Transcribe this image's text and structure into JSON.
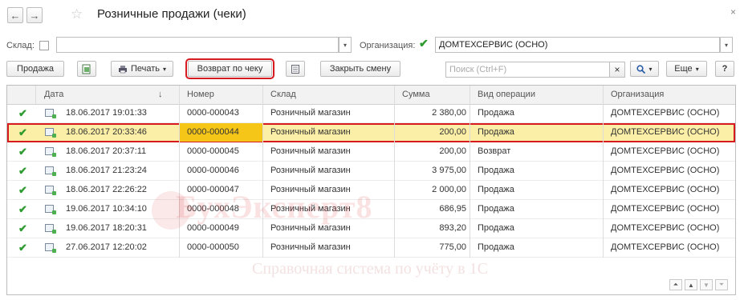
{
  "window": {
    "title": "Розничные продажи (чеки)",
    "close_glyph": "×",
    "back_glyph": "←",
    "forward_glyph": "→",
    "favorite_glyph": "☆"
  },
  "filters": {
    "warehouse_label": "Склад:",
    "warehouse_value": "",
    "warehouse_checked": false,
    "org_label": "Организация:",
    "org_checked": true,
    "org_value": "ДОМТЕХСЕРВИС (ОСНО)",
    "dropdown_glyph": "▾"
  },
  "toolbar": {
    "sale_label": "Продажа",
    "print_label": "Печать",
    "return_label": "Возврат по чеку",
    "close_shift_label": "Закрыть смену",
    "search_placeholder": "Поиск (Ctrl+F)",
    "clear_glyph": "×",
    "more_label": "Еще",
    "help_label": "?",
    "dropdown_glyph": "▾",
    "sort_glyph": "↓"
  },
  "table": {
    "columns": [
      "Дата",
      "Номер",
      "Склад",
      "Сумма",
      "Вид операции",
      "Организация"
    ],
    "check_glyph": "✔",
    "rows": [
      {
        "date": "18.06.2017 19:01:33",
        "number": "0000-000043",
        "warehouse": "Розничный магазин",
        "sum": "2 380,00",
        "operation": "Продажа",
        "org": "ДОМТЕХСЕРВИС (ОСНО)"
      },
      {
        "date": "18.06.2017 20:33:46",
        "number": "0000-000044",
        "warehouse": "Розничный магазин",
        "sum": "200,00",
        "operation": "Продажа",
        "org": "ДОМТЕХСЕРВИС (ОСНО)"
      },
      {
        "date": "18.06.2017 20:37:11",
        "number": "0000-000045",
        "warehouse": "Розничный магазин",
        "sum": "200,00",
        "operation": "Возврат",
        "org": "ДОМТЕХСЕРВИС (ОСНО)"
      },
      {
        "date": "18.06.2017 21:23:24",
        "number": "0000-000046",
        "warehouse": "Розничный магазин",
        "sum": "3 975,00",
        "operation": "Продажа",
        "org": "ДОМТЕХСЕРВИС (ОСНО)"
      },
      {
        "date": "18.06.2017 22:26:22",
        "number": "0000-000047",
        "warehouse": "Розничный магазин",
        "sum": "2 000,00",
        "operation": "Продажа",
        "org": "ДОМТЕХСЕРВИС (ОСНО)"
      },
      {
        "date": "19.06.2017 10:34:10",
        "number": "0000-000048",
        "warehouse": "Розничный магазин",
        "sum": "686,95",
        "operation": "Продажа",
        "org": "ДОМТЕХСЕРВИС (ОСНО)"
      },
      {
        "date": "19.06.2017 18:20:31",
        "number": "0000-000049",
        "warehouse": "Розничный магазин",
        "sum": "893,20",
        "operation": "Продажа",
        "org": "ДОМТЕХСЕРВИС (ОСНО)"
      },
      {
        "date": "27.06.2017 12:20:02",
        "number": "0000-000050",
        "warehouse": "Розничный магазин",
        "sum": "775,00",
        "operation": "Продажа",
        "org": "ДОМТЕХСЕРВИС (ОСНО)"
      }
    ]
  },
  "watermark": {
    "line1": "БухЭксперт8",
    "line2": "Справочная система по учёту в 1С"
  },
  "pager": {
    "first_glyph": "⏶",
    "prev_glyph": "▲",
    "next_glyph": "▼",
    "last_glyph": "⏷"
  },
  "colors": {
    "highlight_outline": "#d71920",
    "selected_row": "#fbeea6",
    "selected_cell": "#f5c518",
    "check_green": "#2e9b2e"
  }
}
